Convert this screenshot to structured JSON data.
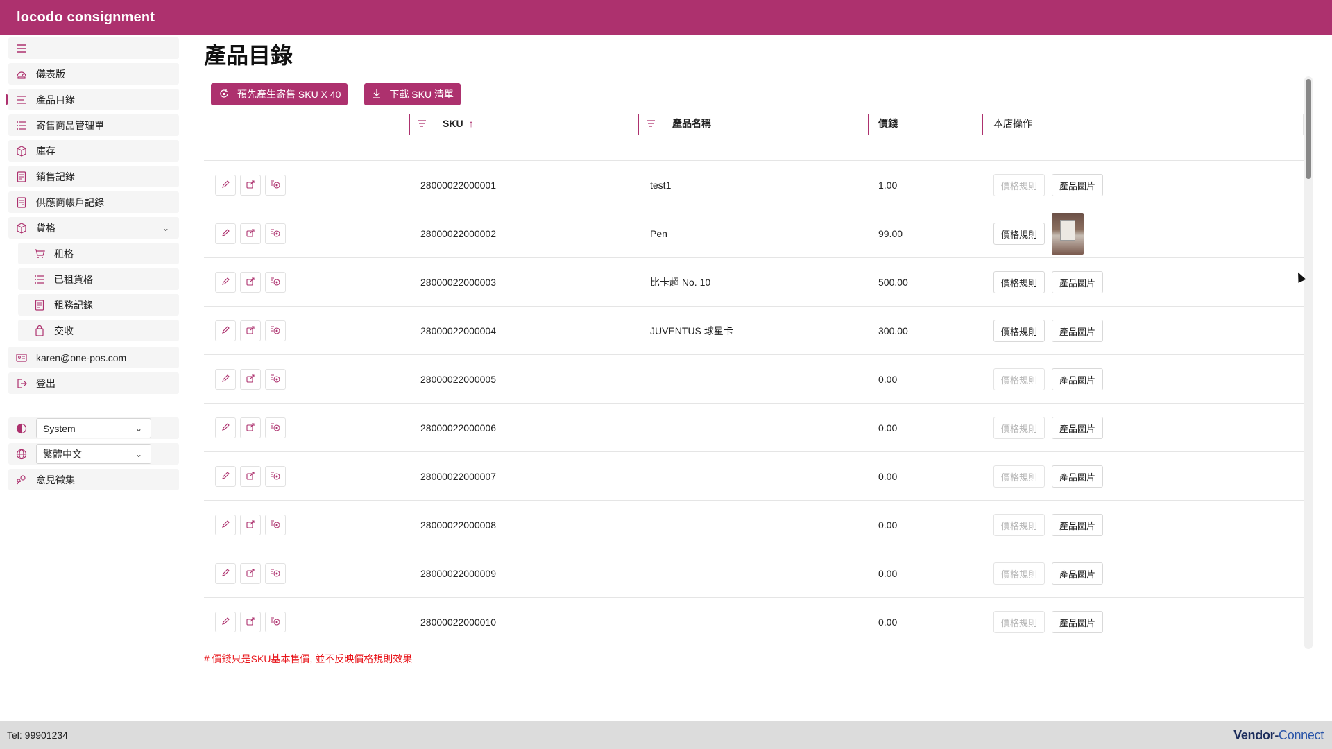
{
  "app": {
    "brand": "locodo consignment"
  },
  "sidebar": {
    "items": [
      {
        "label": "儀表版",
        "icon": "dashboard-icon"
      },
      {
        "label": "產品目錄",
        "icon": "list-icon",
        "active": true
      },
      {
        "label": "寄售商品管理單",
        "icon": "list-check-icon"
      },
      {
        "label": "庫存",
        "icon": "box-icon"
      },
      {
        "label": "銷售記錄",
        "icon": "receipt-icon"
      },
      {
        "label": "供應商帳戶記錄",
        "icon": "ledger-icon"
      },
      {
        "label": "貨格",
        "icon": "shelf-box-icon",
        "expanded": true
      }
    ],
    "sub_items": [
      {
        "label": "租格",
        "icon": "cart-icon"
      },
      {
        "label": "已租貨格",
        "icon": "list-icon"
      },
      {
        "label": "租務記錄",
        "icon": "receipt-icon"
      },
      {
        "label": "交收",
        "icon": "bag-icon"
      }
    ],
    "account": {
      "email": "karen@one-pos.com",
      "logout": "登出"
    },
    "theme_select": "System",
    "language_select": "繁體中文",
    "feedback": "意見徵集"
  },
  "main": {
    "title": "產品目錄",
    "buttons": {
      "pregenerate": "預先產生寄售 SKU X 40",
      "download": "下載 SKU 清單"
    },
    "table": {
      "headers": {
        "sku": "SKU",
        "name": "產品名稱",
        "price": "價錢",
        "actions": "本店操作"
      },
      "sort": {
        "column": "SKU",
        "direction": "ascending"
      },
      "price_rule_label": "價格規則",
      "image_label": "產品圖片",
      "rows": [
        {
          "sku": "28000022000001",
          "name": "test1",
          "price": "1.00",
          "price_rule_enabled": false,
          "has_image": false
        },
        {
          "sku": "28000022000002",
          "name": "Pen",
          "price": "99.00",
          "price_rule_enabled": true,
          "has_image": true
        },
        {
          "sku": "28000022000003",
          "name": "比卡超 No. 10",
          "price": "500.00",
          "price_rule_enabled": true,
          "has_image": false
        },
        {
          "sku": "28000022000004",
          "name": "JUVENTUS 球星卡",
          "price": "300.00",
          "price_rule_enabled": true,
          "has_image": false
        },
        {
          "sku": "28000022000005",
          "name": "",
          "price": "0.00",
          "price_rule_enabled": false,
          "has_image": false
        },
        {
          "sku": "28000022000006",
          "name": "",
          "price": "0.00",
          "price_rule_enabled": false,
          "has_image": false
        },
        {
          "sku": "28000022000007",
          "name": "",
          "price": "0.00",
          "price_rule_enabled": false,
          "has_image": false
        },
        {
          "sku": "28000022000008",
          "name": "",
          "price": "0.00",
          "price_rule_enabled": false,
          "has_image": false
        },
        {
          "sku": "28000022000009",
          "name": "",
          "price": "0.00",
          "price_rule_enabled": false,
          "has_image": false
        },
        {
          "sku": "28000022000010",
          "name": "",
          "price": "0.00",
          "price_rule_enabled": false,
          "has_image": false
        }
      ]
    },
    "note": "# 價錢只是SKU基本售價, 並不反映價格規則效果"
  },
  "footer": {
    "tel": "Tel: 99901234",
    "logo_part1": "Vendor-",
    "logo_part2": "Connect"
  },
  "colors": {
    "brand": "#ad316e",
    "warning": "#e8141a",
    "footer_bg": "#dcdcdc"
  }
}
